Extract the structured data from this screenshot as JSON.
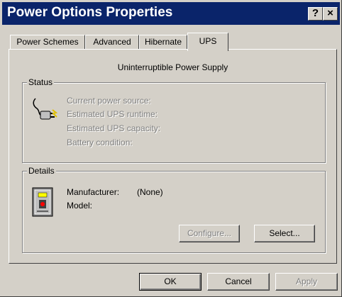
{
  "window": {
    "title": "Power Options Properties",
    "help_label": "?",
    "close_label": "×"
  },
  "tabs": [
    {
      "label": "Power Schemes",
      "selected": false
    },
    {
      "label": "Advanced",
      "selected": false
    },
    {
      "label": "Hibernate",
      "selected": false
    },
    {
      "label": "UPS",
      "selected": true
    }
  ],
  "ups": {
    "heading": "Uninterruptible Power Supply",
    "status": {
      "label": "Status",
      "icon": "power-plug-icon",
      "lines": [
        "Current power source:",
        "Estimated UPS runtime:",
        "Estimated UPS capacity:",
        "Battery condition:"
      ]
    },
    "details": {
      "label": "Details",
      "icon": "ups-device-icon",
      "manufacturer_label": "Manufacturer:",
      "manufacturer_value": "(None)",
      "model_label": "Model:",
      "model_value": "",
      "configure_label": "Configure...",
      "select_label": "Select..."
    }
  },
  "buttons": {
    "ok": "OK",
    "cancel": "Cancel",
    "apply": "Apply"
  },
  "colors": {
    "titlebar": "#0a246a",
    "face": "#d4d0c8",
    "disabled_text": "#808080"
  }
}
